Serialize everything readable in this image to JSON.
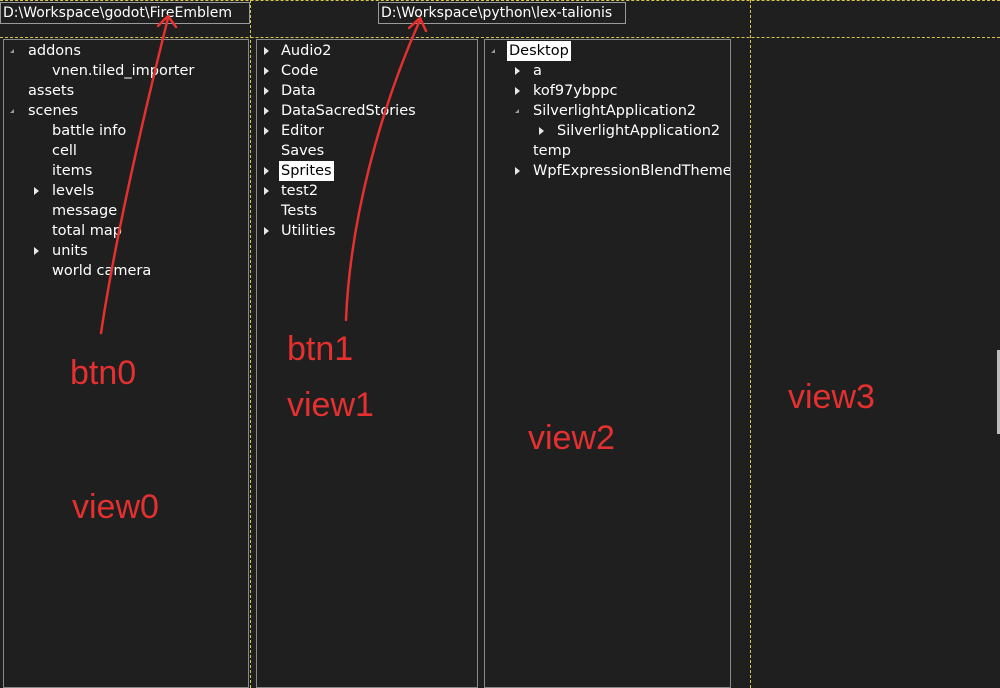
{
  "buttons": {
    "btn0_path": "D:\\Workspace\\godot\\FireEmblem",
    "btn1_path": "D:\\Workspace\\python\\lex-talionis"
  },
  "view0": {
    "items": [
      {
        "label": "addons",
        "state": "expanded"
      },
      {
        "label": "vnen.tiled_importer",
        "state": "leaf"
      },
      {
        "label": "assets",
        "state": "leaf"
      },
      {
        "label": "scenes",
        "state": "expanded"
      },
      {
        "label": "battle info",
        "state": "leaf"
      },
      {
        "label": "cell",
        "state": "leaf"
      },
      {
        "label": "items",
        "state": "leaf"
      },
      {
        "label": "levels",
        "state": "collapsed"
      },
      {
        "label": "message",
        "state": "leaf"
      },
      {
        "label": "total map",
        "state": "leaf"
      },
      {
        "label": "units",
        "state": "collapsed"
      },
      {
        "label": "world camera",
        "state": "leaf"
      }
    ]
  },
  "view1": {
    "items": [
      {
        "label": "Audio2",
        "state": "collapsed"
      },
      {
        "label": "Code",
        "state": "collapsed"
      },
      {
        "label": "Data",
        "state": "collapsed"
      },
      {
        "label": "DataSacredStories",
        "state": "collapsed"
      },
      {
        "label": "Editor",
        "state": "collapsed"
      },
      {
        "label": "Saves",
        "state": "leaf"
      },
      {
        "label": "Sprites",
        "state": "collapsed",
        "selected": true
      },
      {
        "label": "test2",
        "state": "collapsed"
      },
      {
        "label": "Tests",
        "state": "leaf"
      },
      {
        "label": "Utilities",
        "state": "collapsed"
      }
    ]
  },
  "view2": {
    "items": [
      {
        "label": "Desktop",
        "state": "expanded",
        "selected": true
      },
      {
        "label": "a",
        "state": "collapsed"
      },
      {
        "label": "kof97ybppc",
        "state": "collapsed"
      },
      {
        "label": "SilverlightApplication2",
        "state": "expanded"
      },
      {
        "label": "SilverlightApplication2",
        "state": "collapsed"
      },
      {
        "label": "temp",
        "state": "leaf"
      },
      {
        "label": "WpfExpressionBlendTheme",
        "state": "collapsed"
      }
    ]
  },
  "annotations": {
    "btn0": "btn0",
    "btn1": "btn1",
    "view0": "view0",
    "view1": "view1",
    "view2": "view2",
    "view3": "view3"
  },
  "colors": {
    "background": "#1f1f1f",
    "guide": "#d8c64a",
    "annotation": "#e53030",
    "selection_bg": "#ffffff"
  },
  "icons": {
    "expanded": "expanded-triangle-icon",
    "collapsed": "collapsed-triangle-icon"
  }
}
